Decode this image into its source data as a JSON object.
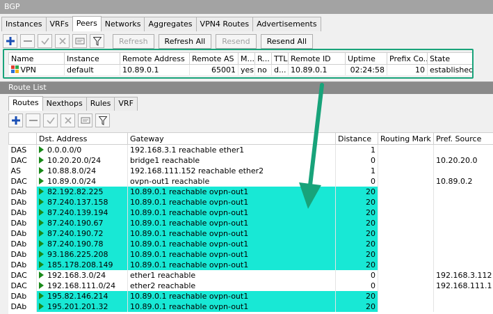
{
  "bgp_window": {
    "title": "BGP",
    "tabs": [
      "Instances",
      "VRFs",
      "Peers",
      "Networks",
      "Aggregates",
      "VPN4 Routes",
      "Advertisements"
    ],
    "toolbar": {
      "refresh": "Refresh",
      "refresh_all": "Refresh All",
      "resend": "Resend",
      "resend_all": "Resend All"
    },
    "peers_table": {
      "headers": [
        "Name",
        "Instance",
        "Remote Address",
        "Remote AS",
        "M...",
        "R...",
        "TTL",
        "Remote ID",
        "Uptime",
        "Prefix Co...",
        "State"
      ],
      "row": {
        "name": "VPN",
        "instance": "default",
        "remote_address": "10.89.0.1",
        "remote_as": "65001",
        "m": "yes",
        "r": "no",
        "ttl": "d...",
        "remote_id": "10.89.0.1",
        "uptime": "02:24:58",
        "prefix_count": "10",
        "state": "established"
      }
    }
  },
  "route_window": {
    "title": "Route List",
    "tabs": [
      "Routes",
      "Nexthops",
      "Rules",
      "VRF"
    ],
    "headers": [
      "",
      "Dst. Address",
      "Gateway",
      "Distance",
      "Routing Mark",
      "Pref. Source"
    ],
    "rows": [
      {
        "flags": "DAS",
        "dst": "0.0.0.0/0",
        "gateway": "192.168.3.1 reachable ether1",
        "distance": "1",
        "mark": "",
        "pref": "",
        "highlight": false
      },
      {
        "flags": "DAC",
        "dst": "10.20.20.0/24",
        "gateway": "bridge1 reachable",
        "distance": "0",
        "mark": "",
        "pref": "10.20.20.0",
        "highlight": false
      },
      {
        "flags": "AS",
        "dst": "10.88.8.0/24",
        "gateway": "192.168.111.152 reachable ether2",
        "distance": "1",
        "mark": "",
        "pref": "",
        "highlight": false
      },
      {
        "flags": "DAC",
        "dst": "10.89.0.0/24",
        "gateway": "ovpn-out1 reachable",
        "distance": "0",
        "mark": "",
        "pref": "10.89.0.2",
        "highlight": false
      },
      {
        "flags": "DAb",
        "dst": "82.192.82.225",
        "gateway": "10.89.0.1 reachable ovpn-out1",
        "distance": "20",
        "mark": "",
        "pref": "",
        "highlight": true
      },
      {
        "flags": "DAb",
        "dst": "87.240.137.158",
        "gateway": "10.89.0.1 reachable ovpn-out1",
        "distance": "20",
        "mark": "",
        "pref": "",
        "highlight": true
      },
      {
        "flags": "DAb",
        "dst": "87.240.139.194",
        "gateway": "10.89.0.1 reachable ovpn-out1",
        "distance": "20",
        "mark": "",
        "pref": "",
        "highlight": true
      },
      {
        "flags": "DAb",
        "dst": "87.240.190.67",
        "gateway": "10.89.0.1 reachable ovpn-out1",
        "distance": "20",
        "mark": "",
        "pref": "",
        "highlight": true
      },
      {
        "flags": "DAb",
        "dst": "87.240.190.72",
        "gateway": "10.89.0.1 reachable ovpn-out1",
        "distance": "20",
        "mark": "",
        "pref": "",
        "highlight": true
      },
      {
        "flags": "DAb",
        "dst": "87.240.190.78",
        "gateway": "10.89.0.1 reachable ovpn-out1",
        "distance": "20",
        "mark": "",
        "pref": "",
        "highlight": true
      },
      {
        "flags": "DAb",
        "dst": "93.186.225.208",
        "gateway": "10.89.0.1 reachable ovpn-out1",
        "distance": "20",
        "mark": "",
        "pref": "",
        "highlight": true
      },
      {
        "flags": "DAb",
        "dst": "185.178.208.149",
        "gateway": "10.89.0.1 reachable ovpn-out1",
        "distance": "20",
        "mark": "",
        "pref": "",
        "highlight": true
      },
      {
        "flags": "DAC",
        "dst": "192.168.3.0/24",
        "gateway": "ether1 reachable",
        "distance": "0",
        "mark": "",
        "pref": "192.168.3.112",
        "highlight": false
      },
      {
        "flags": "DAC",
        "dst": "192.168.111.0/24",
        "gateway": "ether2 reachable",
        "distance": "0",
        "mark": "",
        "pref": "192.168.111.1",
        "highlight": false
      },
      {
        "flags": "DAb",
        "dst": "195.82.146.214",
        "gateway": "10.89.0.1 reachable ovpn-out1",
        "distance": "20",
        "mark": "",
        "pref": "",
        "highlight": true
      },
      {
        "flags": "DAb",
        "dst": "195.201.201.32",
        "gateway": "10.89.0.1 reachable ovpn-out1",
        "distance": "20",
        "mark": "",
        "pref": "",
        "highlight": true
      }
    ]
  },
  "colors": {
    "highlight": "#18e8d5",
    "annotation": "#18a37a",
    "add_icon": "#1a4fb5",
    "route_arrow": "#1a8a1a"
  },
  "icons": [
    "add-icon",
    "remove-icon",
    "enable-icon",
    "disable-icon",
    "comment-icon",
    "filter-icon",
    "peer-icon",
    "route-active-icon"
  ]
}
